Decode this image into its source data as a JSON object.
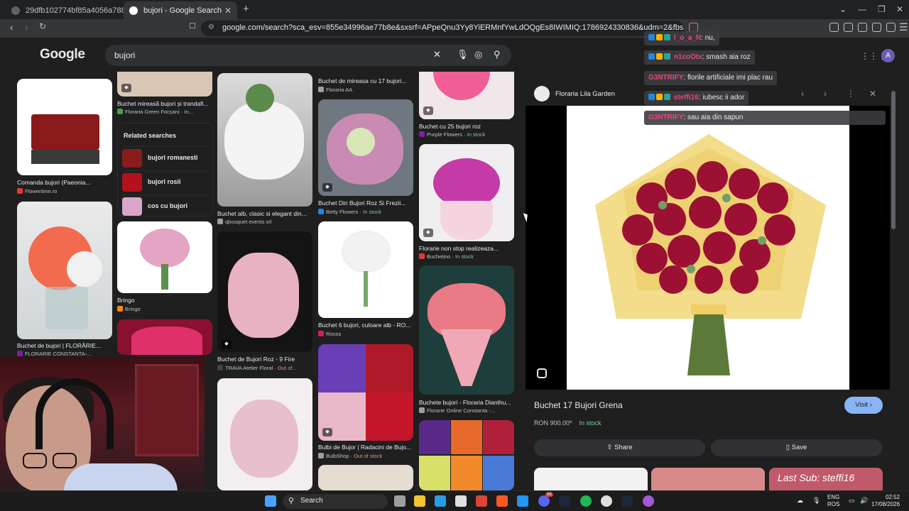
{
  "browser": {
    "tabs": [
      {
        "title": "29dfb102774bf85a4056a788c4ee21f..."
      },
      {
        "title": "bujori - Google Search"
      }
    ],
    "url": "google.com/search?sca_esv=855e34996ae77b8e&sxsrf=APpeQnu3Yy8YiERMnfYwLdOQgEs8IWIMIQ:1786924330836&udm=2&fbs=ABfTbFVyMZGff1hfv..."
  },
  "google": {
    "logo": "Google",
    "query": "bujori"
  },
  "results": [
    {
      "caption": "Comanda bujori (Paeonia...",
      "source": "Flowertime.ro",
      "stock": ""
    },
    {
      "caption": "Buchet de bujori | FLORĂRIE...",
      "source": "FLORARIE CONSTANTA-...",
      "stock": ""
    },
    {
      "caption": "Buchet mireasă bujori și trandafi...",
      "source": "Floraria Green Focșani · In...",
      "stock": ""
    },
    {
      "caption": "Bringo",
      "source": "Bringo",
      "stock": ""
    },
    {
      "caption": "Buchet alb, clasic si elegant din...",
      "source": "qbouquet events srl",
      "stock": ""
    },
    {
      "caption": "Buchet de Bujori Roz - 9 Fire",
      "source": "TRAVA Atelier Floral",
      "stock": "Out of..."
    },
    {
      "caption": "Buchet de mireasa cu 17 bujori...",
      "source": "Floraria AA",
      "stock": ""
    },
    {
      "caption": "Buchet Din Bujori Roz Si Frezii...",
      "source": "Betty Flowers",
      "stock": "In stock"
    },
    {
      "caption": "Buchet 6 bujori, culoare alb - RO...",
      "source": "Rocos",
      "stock": ""
    },
    {
      "caption": "Bulbi de Bujor | Radacini de Bujo...",
      "source": "BulbShop",
      "stock": "Out of stock"
    },
    {
      "caption": "Buchet cu 25 bujori roz",
      "source": "Purple Flowers",
      "stock": "In stock"
    },
    {
      "caption": "Florarie non stop realizeaza...",
      "source": "Buchetino",
      "stock": "In stock"
    },
    {
      "caption": "Buchete bujori - Floraria Dianthu...",
      "source": "Florarie Online Constanta -...",
      "stock": ""
    }
  ],
  "related": {
    "title": "Related searches",
    "items": [
      {
        "label": "bujori romanesti"
      },
      {
        "label": "bujori rosii"
      },
      {
        "label": "cos cu bujori"
      }
    ]
  },
  "panel": {
    "source": "Floraria Lila Garden",
    "title": "Buchet 17 Bujori Grena",
    "price": "RON 900.00*",
    "stock": "In stock",
    "visit": "Visit",
    "share": "Share",
    "save": "Save"
  },
  "chat": [
    {
      "user": "l_o_a_N",
      "text": ": nu,",
      "color": "#e8467c"
    },
    {
      "user": "n1coOtx",
      "text": ": smash aia roz",
      "color": "#e8467c"
    },
    {
      "user": "G3NTRIFY",
      "text": ": florile artificiale imi plac rau",
      "color": "#e8467c"
    },
    {
      "user": "steffi16",
      "text": ": iubesc ii ador",
      "color": "#e8467c"
    },
    {
      "user": "G3NTRIFY",
      "text": ": sau aia din sapun",
      "color": "#e8467c"
    }
  ],
  "stream": {
    "last_sub": "Last Sub: steffi16"
  },
  "account": {
    "initial": "A"
  },
  "taskbar": {
    "search": "Search",
    "lang1": "ENG",
    "lang2": "ROS",
    "time": "02:52",
    "date": "17/08/2026",
    "badge": "99"
  }
}
